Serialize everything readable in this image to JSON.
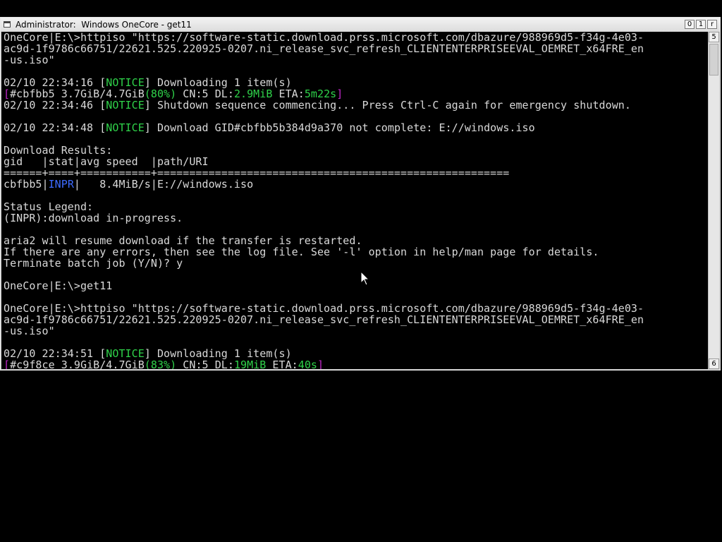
{
  "window": {
    "title": "Administrator:  Windows OneCore - get11",
    "buttons": {
      "minimize": "0",
      "maximize": "1",
      "close": "r"
    }
  },
  "scrollbar": {
    "up_glyph": "5",
    "down_glyph": "6"
  },
  "console": {
    "lines": [
      [
        {
          "t": "OneCore|E:\\>httpiso \"https://software-static.download.prss.microsoft.com/dbazure/988969d5-f34g-4e03-",
          "c": "gray"
        }
      ],
      [
        {
          "t": "ac9d-1f9786c66751/22621.525.220925-0207.ni_release_svc_refresh_CLIENTENTERPRISEEVAL_OEMRET_x64FRE_en",
          "c": "gray"
        }
      ],
      [
        {
          "t": "-us.iso\"",
          "c": "gray"
        }
      ],
      [
        {
          "t": "",
          "c": "gray"
        }
      ],
      [
        {
          "t": "02/10 22:34:16 [",
          "c": "gray"
        },
        {
          "t": "NOTICE",
          "c": "green"
        },
        {
          "t": "] Downloading 1 item(s)",
          "c": "gray"
        }
      ],
      [
        {
          "t": "[",
          "c": "magenta"
        },
        {
          "t": "#cbfbb5 3.7GiB/4.7GiB",
          "c": "gray"
        },
        {
          "t": "(80%)",
          "c": "green"
        },
        {
          "t": " CN:5 DL:",
          "c": "gray"
        },
        {
          "t": "2.9MiB",
          "c": "green"
        },
        {
          "t": " ETA:",
          "c": "gray"
        },
        {
          "t": "5m22s",
          "c": "green"
        },
        {
          "t": "]",
          "c": "magenta"
        }
      ],
      [
        {
          "t": "02/10 22:34:46 [",
          "c": "gray"
        },
        {
          "t": "NOTICE",
          "c": "green"
        },
        {
          "t": "] Shutdown sequence commencing... Press Ctrl-C again for emergency shutdown.",
          "c": "gray"
        }
      ],
      [
        {
          "t": "",
          "c": "gray"
        }
      ],
      [
        {
          "t": "02/10 22:34:48 [",
          "c": "gray"
        },
        {
          "t": "NOTICE",
          "c": "green"
        },
        {
          "t": "] Download GID#cbfbb5b384d9a370 not complete: E://windows.iso",
          "c": "gray"
        }
      ],
      [
        {
          "t": "",
          "c": "gray"
        }
      ],
      [
        {
          "t": "Download Results:",
          "c": "gray"
        }
      ],
      [
        {
          "t": "gid   |stat|avg speed  |path/URI",
          "c": "gray"
        }
      ],
      [
        {
          "t": "======+====+===========+=======================================================",
          "c": "gray"
        }
      ],
      [
        {
          "t": "cbfbb5|",
          "c": "gray"
        },
        {
          "t": "INPR",
          "c": "blue"
        },
        {
          "t": "|   8.4MiB/s|E://windows.iso",
          "c": "gray"
        }
      ],
      [
        {
          "t": "",
          "c": "gray"
        }
      ],
      [
        {
          "t": "Status Legend:",
          "c": "gray"
        }
      ],
      [
        {
          "t": "(INPR):download in-progress.",
          "c": "gray"
        }
      ],
      [
        {
          "t": "",
          "c": "gray"
        }
      ],
      [
        {
          "t": "aria2 will resume download if the transfer is restarted.",
          "c": "gray"
        }
      ],
      [
        {
          "t": "If there are any errors, then see the log file. See '-l' option in help/man page for details.",
          "c": "gray"
        }
      ],
      [
        {
          "t": "Terminate batch job (Y/N)? y",
          "c": "gray"
        }
      ],
      [
        {
          "t": "",
          "c": "gray"
        }
      ],
      [
        {
          "t": "OneCore|E:\\>get11",
          "c": "gray"
        }
      ],
      [
        {
          "t": "",
          "c": "gray"
        }
      ],
      [
        {
          "t": "OneCore|E:\\>httpiso \"https://software-static.download.prss.microsoft.com/dbazure/988969d5-f34g-4e03-",
          "c": "gray"
        }
      ],
      [
        {
          "t": "ac9d-1f9786c66751/22621.525.220925-0207.ni_release_svc_refresh_CLIENTENTERPRISEEVAL_OEMRET_x64FRE_en",
          "c": "gray"
        }
      ],
      [
        {
          "t": "-us.iso\"",
          "c": "gray"
        }
      ],
      [
        {
          "t": "",
          "c": "gray"
        }
      ],
      [
        {
          "t": "02/10 22:34:51 [",
          "c": "gray"
        },
        {
          "t": "NOTICE",
          "c": "green"
        },
        {
          "t": "] Downloading 1 item(s)",
          "c": "gray"
        }
      ],
      [
        {
          "t": "[",
          "c": "magenta"
        },
        {
          "t": "#c9f8ce 3.9GiB/4.7GiB",
          "c": "gray"
        },
        {
          "t": "(83%)",
          "c": "green"
        },
        {
          "t": " CN:5 DL:",
          "c": "gray"
        },
        {
          "t": "19MiB",
          "c": "green"
        },
        {
          "t": " ETA:",
          "c": "gray"
        },
        {
          "t": "40s",
          "c": "green"
        },
        {
          "t": "]",
          "c": "magenta"
        }
      ]
    ]
  },
  "colors": {
    "background": "#000000",
    "text": "#d9d9d9",
    "green": "#2fd34a",
    "magenta": "#c026c8",
    "blue": "#3d6bff"
  }
}
